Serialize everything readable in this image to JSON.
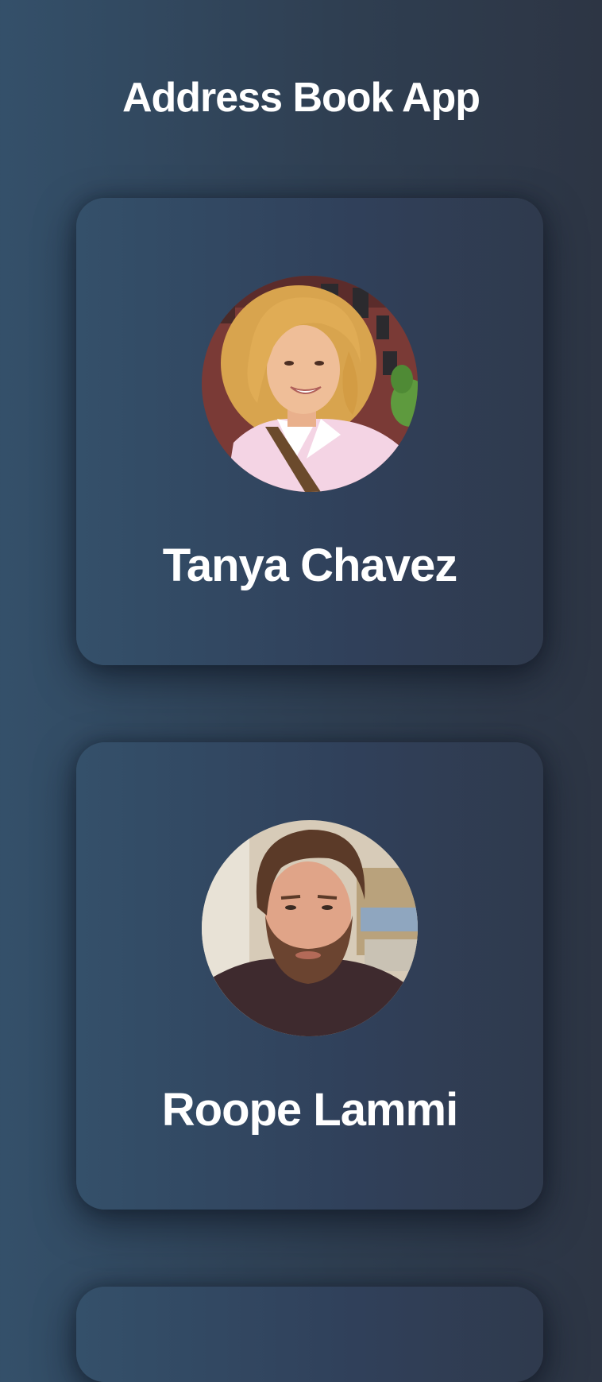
{
  "app": {
    "title": "Address Book App"
  },
  "contacts": [
    {
      "name": "Tanya Chavez",
      "avatar_icon": "contact-photo"
    },
    {
      "name": "Roope Lammi",
      "avatar_icon": "contact-photo"
    },
    {
      "name": "",
      "avatar_icon": ""
    }
  ],
  "colors": {
    "background_start": "#34506a",
    "background_end": "#2d3544",
    "card": "#32465e",
    "text": "#ffffff"
  }
}
